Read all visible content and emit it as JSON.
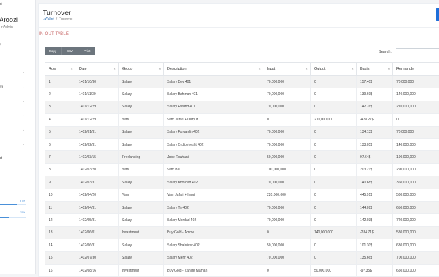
{
  "sidebar": {
    "brand_fragment": "et",
    "user_name": "Aroozi",
    "user_role": "r Admin",
    "marks": [
      "y",
      "im",
      "rd"
    ],
    "progress": [
      {
        "label": "67%",
        "value": 0.67
      },
      {
        "label": "35%",
        "value": 0.35
      }
    ]
  },
  "header": {
    "title": "Turnover",
    "breadcrumb_home": "Wallet",
    "breadcrumb_current": "Turnover"
  },
  "section_label": "IN-OUT TABLE",
  "toolbar": {
    "copy_label": "Copy",
    "csv_label": "CSV",
    "print_label": "Print"
  },
  "search": {
    "label": "Search:",
    "value": ""
  },
  "table": {
    "columns": [
      "Row",
      "Date",
      "Group",
      "Description",
      "Input",
      "Output",
      "Basis",
      "Remainder"
    ],
    "rows": [
      [
        "1",
        "1401/10/30",
        "Salary",
        "Salary Dey 401",
        "70,000,000",
        "0",
        "157.40$",
        "70,000,000"
      ],
      [
        "2",
        "1401/11/30",
        "Salary",
        "Salary Bahman 401",
        "70,000,000",
        "0",
        "139.69$",
        "140,000,000"
      ],
      [
        "3",
        "1401/12/29",
        "Salary",
        "Salary Esfand 401",
        "70,000,000",
        "0",
        "142.76$",
        "210,000,000"
      ],
      [
        "4",
        "1401/12/29",
        "Vam",
        "Vam Jafari + Output",
        "0",
        "210,000,000",
        "-428.27$",
        "0"
      ],
      [
        "5",
        "1402/01/31",
        "Salary",
        "Salary Forvardin 402",
        "70,000,000",
        "0",
        "134.13$",
        "70,000,000"
      ],
      [
        "6",
        "1402/02/31",
        "Salary",
        "Salary Ordibehesht 402",
        "70,000,000",
        "0",
        "133.05$",
        "140,000,000"
      ],
      [
        "7",
        "1402/03/15",
        "Freelancing",
        "Jobe Rouhani",
        "50,000,000",
        "0",
        "97.64$",
        "190,000,000"
      ],
      [
        "8",
        "1402/03/20",
        "Vam",
        "Vam Blu",
        "100,000,000",
        "0",
        "203.21$",
        "290,000,000"
      ],
      [
        "9",
        "1402/03/31",
        "Salary",
        "Salary Khordad 402",
        "70,000,000",
        "0",
        "140.68$",
        "360,000,000"
      ],
      [
        "10",
        "1402/04/20",
        "Vam",
        "Vam Jafari + Input",
        "220,000,000",
        "0",
        "445.91$",
        "580,000,000"
      ],
      [
        "11",
        "1402/04/31",
        "Salary",
        "Salary Tir 402",
        "70,000,000",
        "0",
        "144.09$",
        "650,000,000"
      ],
      [
        "12",
        "1402/05/31",
        "Salary",
        "Salary Mordad 402",
        "70,000,000",
        "0",
        "142.03$",
        "720,000,000"
      ],
      [
        "13",
        "1402/06/01",
        "Investment",
        "Buy Gold - Amme",
        "0",
        "140,000,000",
        "-284.71$",
        "580,000,000"
      ],
      [
        "14",
        "1402/06/31",
        "Salary",
        "Salary Shahrivar 402",
        "50,000,000",
        "0",
        "101.30$",
        "630,000,000"
      ],
      [
        "15",
        "1402/07/30",
        "Salary",
        "Salary Mehr 402",
        "70,000,000",
        "0",
        "135.66$",
        "700,000,000"
      ],
      [
        "16",
        "1402/08/16",
        "Investment",
        "Buy Gold - Zanjire Maman",
        "0",
        "50,000,000",
        "-97.35$",
        "650,000,000"
      ]
    ]
  }
}
